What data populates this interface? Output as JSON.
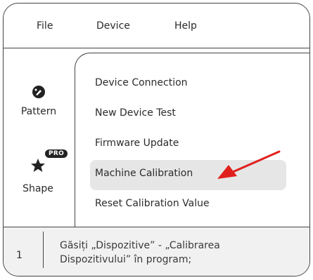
{
  "menubar": {
    "file": "File",
    "device": "Device",
    "help": "Help"
  },
  "sidebar": {
    "items": [
      {
        "label": "Pattern",
        "icon": "pattern-icon"
      },
      {
        "label": "Shape",
        "icon": "star-icon",
        "badge": "PRO"
      }
    ]
  },
  "device_menu": {
    "items": [
      {
        "label": "Device Connection"
      },
      {
        "label": "New Device Test"
      },
      {
        "label": "Firmware Update"
      },
      {
        "label": "Machine Calibration",
        "highlighted": true
      },
      {
        "label": "Reset Calibration Value"
      }
    ]
  },
  "footer": {
    "step": "1",
    "caption": "Găsiți „Dispozitive” - „Calibrarea Dispozitivului” în program;"
  },
  "colors": {
    "arrow": "#e0201c",
    "highlight": "#e6e6e6",
    "footer_bg": "#f1f1f1",
    "border": "#444444"
  }
}
